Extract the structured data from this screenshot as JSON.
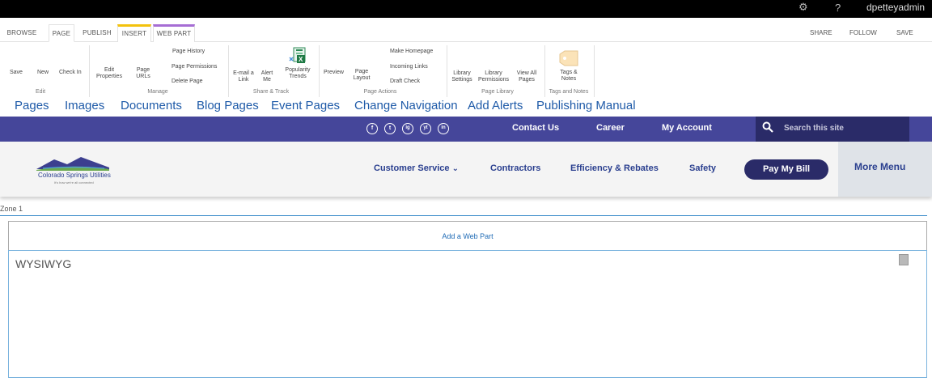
{
  "suitebar": {
    "user": "dpetteyadmin",
    "help": "?",
    "gear_icon": "gear-icon"
  },
  "ribbon_tabs": [
    "BROWSE",
    "PAGE",
    "PUBLISH",
    "INSERT",
    "WEB PART"
  ],
  "ribbon_right": [
    "SHARE",
    "FOLLOW",
    "SAVE"
  ],
  "ribbon": {
    "edit": {
      "save": "Save",
      "new": "New",
      "checkin": "Check In",
      "group": "Edit"
    },
    "manage": {
      "edit_properties_1": "Edit",
      "edit_properties_2": "Properties",
      "page_urls_1": "Page",
      "page_urls_2": "URLs",
      "page_history": "Page History",
      "page_permissions": "Page Permissions",
      "delete_page": "Delete Page",
      "group": "Manage"
    },
    "share": {
      "email_1": "E-mail a",
      "email_2": "Link",
      "alert_1": "Alert",
      "alert_2": "Me",
      "popularity_1": "Popularity",
      "popularity_2": "Trends",
      "group": "Share & Track"
    },
    "actions": {
      "preview": "Preview",
      "page_layout_1": "Page",
      "page_layout_2": "Layout",
      "make_homepage": "Make Homepage",
      "incoming_links": "Incoming Links",
      "draft_check": "Draft Check",
      "group": "Page Actions"
    },
    "library": {
      "lib_settings_1": "Library",
      "lib_settings_2": "Settings",
      "lib_perm_1": "Library",
      "lib_perm_2": "Permissions",
      "view_all_1": "View All",
      "view_all_2": "Pages",
      "group": "Page Library"
    },
    "tags": {
      "tags_1": "Tags &",
      "tags_2": "Notes",
      "group": "Tags and Notes"
    }
  },
  "pubnav": [
    "Pages",
    "Images",
    "Documents",
    "Blog Pages",
    "Event Pages",
    "Change Navigation",
    "Add Alerts",
    "Publishing Manual"
  ],
  "purplebar": {
    "social": [
      "f",
      "t",
      "ig",
      "yt",
      "in"
    ],
    "contact": "Contact Us",
    "career": "Career",
    "account": "My Account",
    "search_placeholder": "Search this site"
  },
  "header": {
    "logo_text": "Colorado Springs Utilities",
    "logo_tagline": "It's how we're all connected",
    "nav": [
      "Customer Service",
      "Contractors",
      "Efficiency & Rebates",
      "Safety"
    ],
    "pay": "Pay My Bill",
    "more": "More Menu",
    "chevron": "⌄"
  },
  "zone": {
    "label": "Zone 1",
    "add_web_part": "Add a Web Part",
    "webpart_title": "WYSIWYG"
  },
  "colors": {
    "purple": "#45469a",
    "dark_purple": "#2a2b68",
    "link_blue": "#1e5aa8",
    "insert_tab": "#f3c20d",
    "webpart_tab": "#a66dd4"
  }
}
